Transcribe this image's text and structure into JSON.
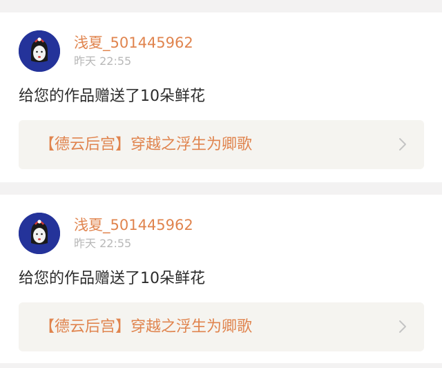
{
  "feed": {
    "items": [
      {
        "user": {
          "name": "浅夏_501445962",
          "avatar_icon": "avatar-face-icon"
        },
        "time": "昨天 22:55",
        "message": "给您的作品赠送了10朵鲜花",
        "work": {
          "title": "【德云后宫】穿越之浮生为卿歌",
          "icon": "chevron-right-icon"
        }
      },
      {
        "user": {
          "name": "浅夏_501445962",
          "avatar_icon": "avatar-face-icon"
        },
        "time": "昨天 22:55",
        "message": "给您的作品赠送了10朵鲜花",
        "work": {
          "title": "【德云后宫】穿越之浮生为卿歌",
          "icon": "chevron-right-icon"
        }
      }
    ]
  },
  "colors": {
    "background": "#f3f2f2",
    "card": "#ffffff",
    "accent": "#e0844e",
    "muted": "#b8b8b8",
    "text": "#2b2b2b",
    "link_bg": "#f5f4f0",
    "avatar_bg": "#24339a"
  }
}
